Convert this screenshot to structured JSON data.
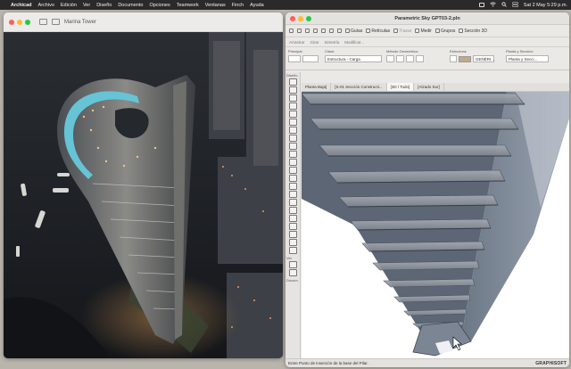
{
  "menubar": {
    "app": "Archicad",
    "items": [
      "Archivo",
      "Edición",
      "Ver",
      "Diseño",
      "Documento",
      "Opciones",
      "Teamwork",
      "Ventanas",
      "Finch",
      "Ayuda"
    ],
    "clock": "Sat 2 May  5:29 p.m."
  },
  "preview": {
    "title": "Marina Tower"
  },
  "archicad": {
    "title": "Parametric Sky GPT03-2.pln",
    "toolbar": {
      "guides": "Guías",
      "grids": "Retículas",
      "trace": "Trazar",
      "measure": "Medir",
      "groups": "Grupos",
      "section3d": "Sección 3D"
    },
    "toolbar2": {
      "move": "Arrastrar",
      "rotate": "Girar",
      "mirror": "Simetría",
      "modify": "Modificar..."
    },
    "info": {
      "main_label": "Principal:",
      "class_label": "Clase:",
      "class_value": "Estructura - Carga",
      "geometry_label": "Método Geométrico:",
      "structure_label": "Estructura:",
      "material_value": "GENÉRI...",
      "floorplan_label": "Planta y Sección:",
      "floorplan_value": "Planta y Secci..."
    },
    "tabs": [
      "Planta Baja]",
      "[S-01 Sección Constructi...",
      "[3D / Todo]",
      "[Alzado Sur]"
    ],
    "toolbox": {
      "design": "Diseño",
      "view": "Ver",
      "doc": "Docum"
    },
    "status": {
      "hint": "Entre Punto de inserción de la base del Pilar.",
      "brand": "GRAPHISOFT"
    }
  }
}
